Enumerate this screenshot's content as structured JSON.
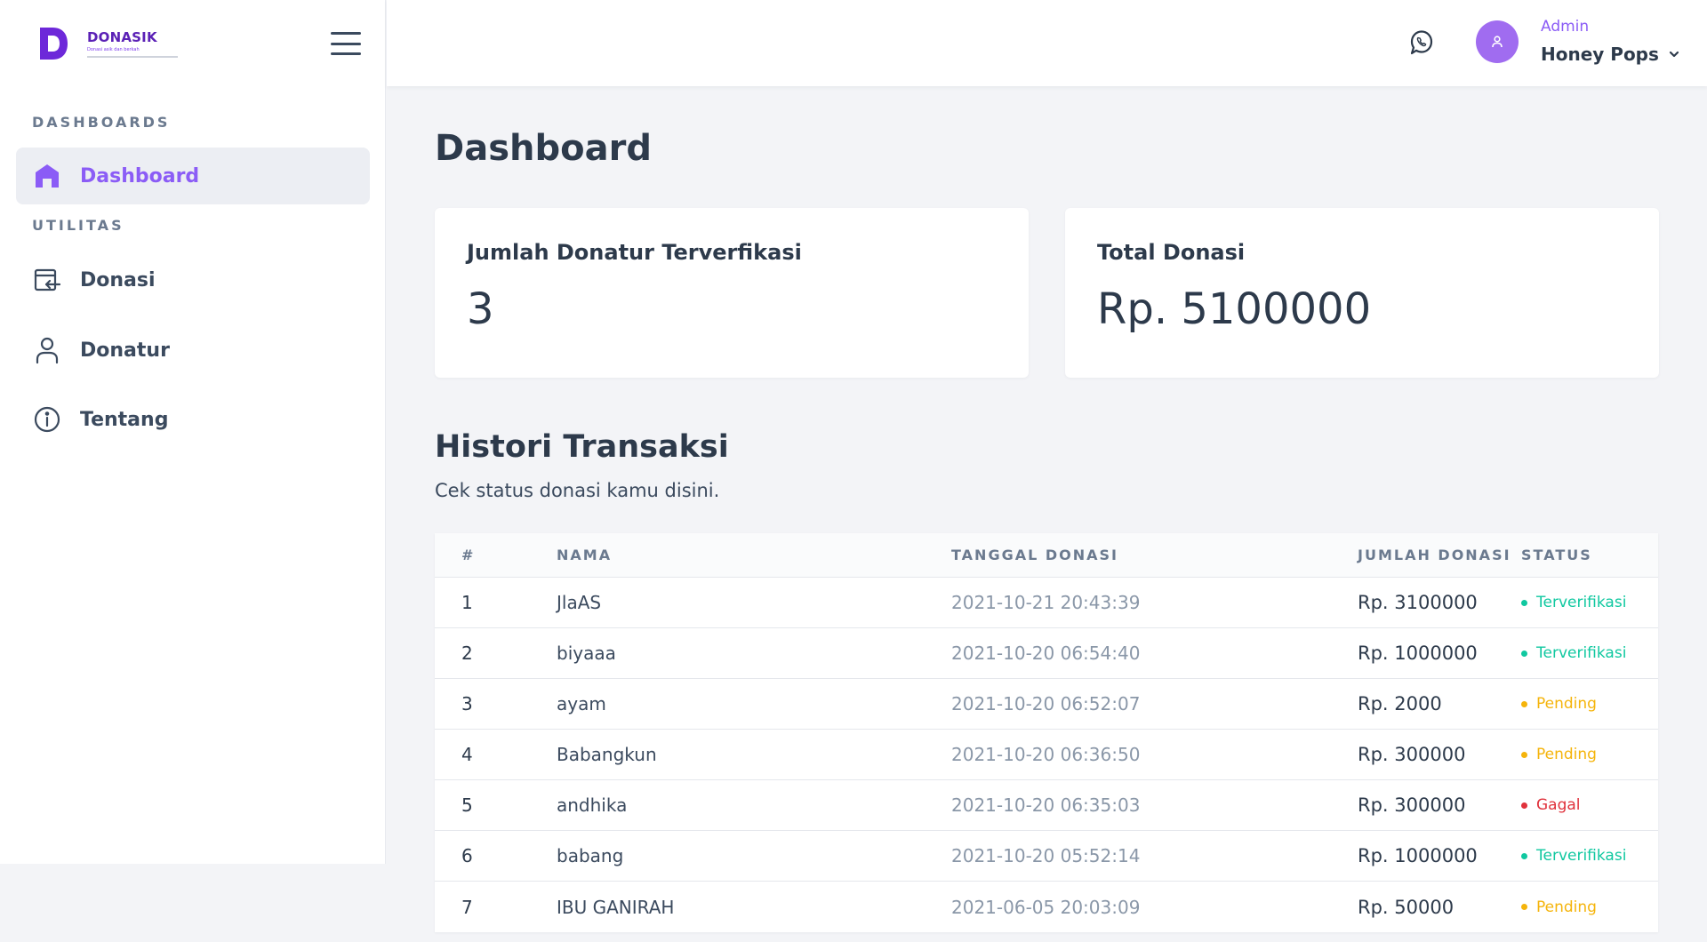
{
  "brand": {
    "name": "DONASIK",
    "tagline": "Donasi asik dan berkah"
  },
  "sidebar": {
    "sections": [
      {
        "label": "DASHBOARDS"
      },
      {
        "label": "UTILITAS"
      }
    ],
    "items": [
      {
        "label": "Dashboard",
        "icon": "home-icon",
        "active": true
      },
      {
        "label": "Donasi",
        "icon": "donation-icon"
      },
      {
        "label": "Donatur",
        "icon": "user-icon"
      },
      {
        "label": "Tentang",
        "icon": "info-icon"
      }
    ]
  },
  "header": {
    "user_role": "Admin",
    "user_name": "Honey Pops"
  },
  "main": {
    "title": "Dashboard",
    "cards": [
      {
        "title": "Jumlah Donatur Terverfikasi",
        "value": "3"
      },
      {
        "title": "Total Donasi",
        "value": "Rp. 5100000"
      }
    ],
    "history": {
      "title": "Histori Transaksi",
      "subtitle": "Cek status donasi kamu disini.",
      "columns": [
        "#",
        "NAMA",
        "TANGGAL DONASI",
        "JUMLAH DONASI",
        "STATUS"
      ],
      "rows": [
        {
          "no": "1",
          "nama": "JlaAS",
          "tanggal": "2021-10-21 20:43:39",
          "jumlah": "Rp. 3100000",
          "status": "Terverifikasi",
          "kind": "ok"
        },
        {
          "no": "2",
          "nama": "biyaaa",
          "tanggal": "2021-10-20 06:54:40",
          "jumlah": "Rp. 1000000",
          "status": "Terverifikasi",
          "kind": "ok"
        },
        {
          "no": "3",
          "nama": "ayam",
          "tanggal": "2021-10-20 06:52:07",
          "jumlah": "Rp. 2000",
          "status": "Pending",
          "kind": "pending"
        },
        {
          "no": "4",
          "nama": "Babangkun",
          "tanggal": "2021-10-20 06:36:50",
          "jumlah": "Rp. 300000",
          "status": "Pending",
          "kind": "pending"
        },
        {
          "no": "5",
          "nama": "andhika",
          "tanggal": "2021-10-20 06:35:03",
          "jumlah": "Rp. 300000",
          "status": "Gagal",
          "kind": "fail"
        },
        {
          "no": "6",
          "nama": "babang",
          "tanggal": "2021-10-20 05:52:14",
          "jumlah": "Rp. 1000000",
          "status": "Terverifikasi",
          "kind": "ok"
        },
        {
          "no": "7",
          "nama": "IBU GANIRAH",
          "tanggal": "2021-06-05 20:03:09",
          "jumlah": "Rp. 50000",
          "status": "Pending",
          "kind": "pending"
        }
      ]
    }
  },
  "colors": {
    "accent": "#8b5cf6",
    "brand": "#5b21b6",
    "status_ok": "#10c8a0",
    "status_pending": "#f5b40b",
    "status_fail": "#e0323c"
  }
}
